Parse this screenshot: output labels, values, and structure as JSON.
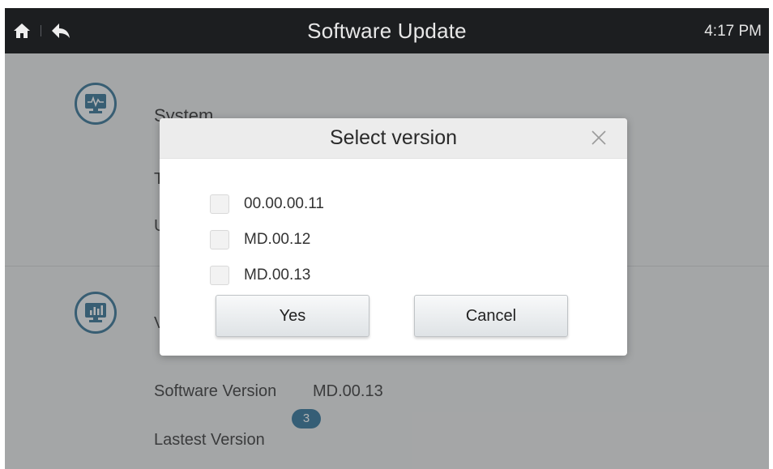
{
  "header": {
    "title": "Software Update",
    "time": "4:17 PM"
  },
  "background": {
    "system_title": "System",
    "row1_partial": "T",
    "row2_partial": "U",
    "section2_partial": "V",
    "software_version_label": "Software Version",
    "software_version_value": "MD.00.13",
    "latest_version_label": "Lastest Version",
    "latest_badge": "3"
  },
  "dialog": {
    "title": "Select version",
    "options": [
      "00.00.00.11",
      "MD.00.12",
      "MD.00.13"
    ],
    "yes_label": "Yes",
    "cancel_label": "Cancel"
  },
  "icons": [
    "home-icon",
    "back-icon",
    "monitor-pulse-icon",
    "monitor-chart-icon",
    "close-icon"
  ],
  "colors": {
    "topbar": "#1c1e20",
    "accent": "#2a6f96"
  }
}
